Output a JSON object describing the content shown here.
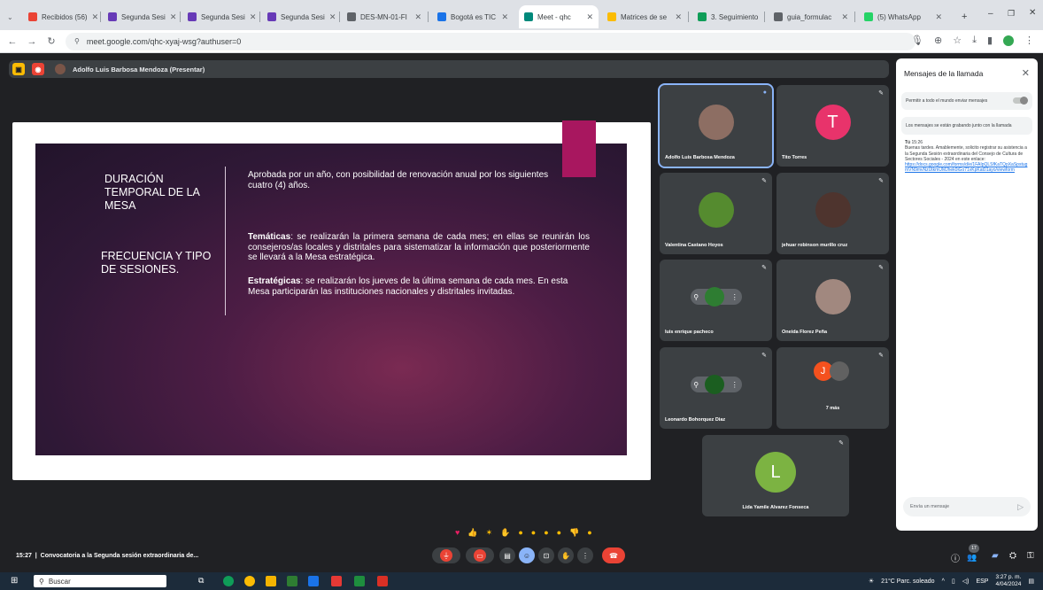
{
  "browser": {
    "tabs": [
      {
        "label": "Recibidos (56)",
        "color": "#ea4335",
        "active": false
      },
      {
        "label": "Segunda Sesi",
        "color": "#673ab7",
        "active": false
      },
      {
        "label": "Segunda Sesi",
        "color": "#673ab7",
        "active": false
      },
      {
        "label": "Segunda Sesi",
        "color": "#673ab7",
        "active": false
      },
      {
        "label": "DES-MN-01-FI",
        "color": "#5f6368",
        "active": false
      },
      {
        "label": "Bogotá es TIC",
        "color": "#1a73e8",
        "active": false
      },
      {
        "label": "Meet - qhc",
        "color": "#00897b",
        "active": true
      },
      {
        "label": "Matrices de se",
        "color": "#fbbc04",
        "active": false
      },
      {
        "label": "3. Seguimiento",
        "color": "#0f9d58",
        "active": false
      },
      {
        "label": "guia_formulac",
        "color": "#5f6368",
        "active": false
      },
      {
        "label": "(5) WhatsApp",
        "color": "#25d366",
        "active": false
      }
    ],
    "new_tab": "+",
    "url": "meet.google.com/qhc-xyaj-wsg?authuser=0"
  },
  "presenter_bar": {
    "label": "Adolfo Luis Barbosa Mendoza (Presentar)"
  },
  "slide": {
    "heading1": "DURACIÓN TEMPORAL DE LA MESA",
    "heading2": "FRECUENCIA Y TIPO DE SESIONES.",
    "para1": "Aprobada por un año, con posibilidad de renovación anual por los siguientes cuatro (4) años.",
    "para2_bold": "Temáticas",
    "para2": ": se realizarán la primera semana de cada mes; en ellas se reunirán los consejeros/as locales y distritales para sistematizar la información que posteriormente se llevará a la Mesa estratégica.",
    "para3_bold": "Estratégicas",
    "para3": ": se realizarán los jueves de la última semana de cada mes. En esta Mesa participarán las instituciones nacionales y distritales invitadas."
  },
  "participants": [
    {
      "name": "Adolfo Luis Barbosa Mendoza",
      "initial": "",
      "color": "#8d6e63",
      "speaking": true
    },
    {
      "name": "Tito Torres",
      "initial": "T",
      "color": "#e8336b",
      "speaking": false
    },
    {
      "name": "Valentina Castano Hoyos",
      "initial": "",
      "color": "#558b2f",
      "speaking": false
    },
    {
      "name": "jehuar robinson murillo cruz",
      "initial": "",
      "color": "#4e342e",
      "speaking": false
    },
    {
      "name": "luis enrique pacheco",
      "initial": "",
      "color": "#2e7d32",
      "speaking": false
    },
    {
      "name": "Oneida Florez Peña",
      "initial": "",
      "color": "#a1887f",
      "speaking": false
    },
    {
      "name": "Leonardo Bohorquez Diaz",
      "initial": "",
      "color": "#1b5e20",
      "speaking": false
    },
    {
      "name": "7 más",
      "initial": "J",
      "color": "#f4511e",
      "speaking": false
    },
    {
      "name": "Lida Yamile Alvarez Fonseca",
      "initial": "L",
      "color": "#7cb342",
      "speaking": false
    }
  ],
  "chat": {
    "title": "Mensajes de la llamada",
    "allow_label": "Permitir a todo el mundo enviar mensajes",
    "recording_notice": "Los mensajes se están grabando junto con la llamada",
    "sender": "Tú",
    "time": "15:26",
    "message": "Buenas tardes. Amablemente, solicito registrar su asistencia a la Segunda Sesión extraordinaria del Consejo de Cultura de Sectores Sociales - 2024 en este enlace:",
    "link": "https://docs.google.com/forms/d/e/1FAIpQLSfKaTQpXaSpstugmVN9mvNzUtkmUMJhek0iGo71vKpKat01ayo/viewform",
    "input_placeholder": "Envía un mensaje"
  },
  "meet_bottom": {
    "time": "15:27",
    "meeting_title": "Convocatoria a la Segunda sesión extraordinaria de...",
    "participant_count": "17"
  },
  "taskbar": {
    "search": "Buscar",
    "weather": "21°C  Parc. soleado",
    "lang": "ESP",
    "time": "3:27 p. m.",
    "date": "4/04/2024"
  }
}
